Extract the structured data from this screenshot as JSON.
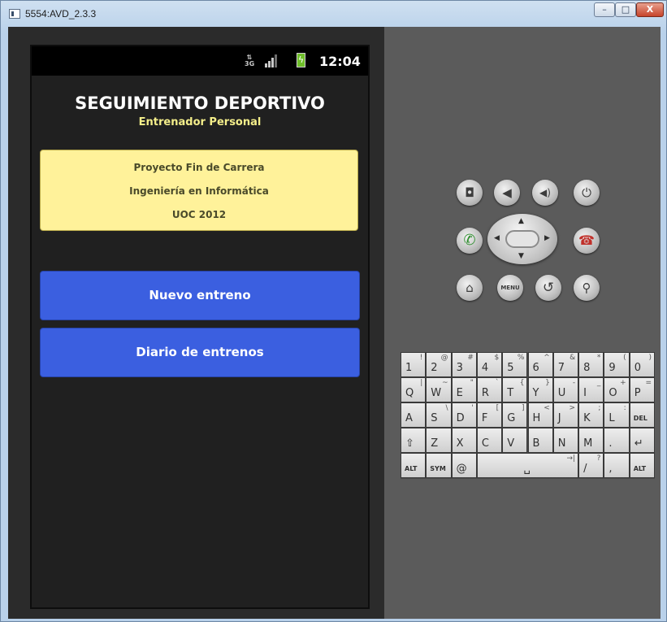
{
  "window": {
    "title": "5554:AVD_2.3.3",
    "min_label": "–",
    "max_label": "□",
    "close_label": "X"
  },
  "statusbar": {
    "network": "3G",
    "clock": "12:04"
  },
  "app": {
    "title": "SEGUIMIENTO DEPORTIVO",
    "subtitle": "Entrenador Personal",
    "info_lines": [
      "Proyecto Fin de Carrera",
      "Ingeniería en Informática",
      "UOC 2012"
    ],
    "buttons": {
      "new": "Nuevo entreno",
      "diary": "Diario de entrenos"
    }
  },
  "emulator": {
    "hardware_buttons": [
      {
        "name": "camera-icon",
        "glyph": "◘"
      },
      {
        "name": "volume-down-icon",
        "glyph": "◀"
      },
      {
        "name": "volume-up-icon",
        "glyph": "◀)"
      },
      {
        "name": "power-icon",
        "glyph": "⏻"
      },
      {
        "name": "call-icon",
        "glyph": "✆"
      },
      {
        "name": "end-call-icon",
        "glyph": "☎"
      },
      {
        "name": "home-icon",
        "glyph": "⌂"
      },
      {
        "name": "menu-icon",
        "glyph": "MENU"
      },
      {
        "name": "back-icon",
        "glyph": "↺"
      },
      {
        "name": "search-icon",
        "glyph": "⚲"
      }
    ],
    "keyboard": {
      "row1": [
        [
          "1",
          "!"
        ],
        [
          "2",
          "@"
        ],
        [
          "3",
          "#"
        ],
        [
          "4",
          "$"
        ],
        [
          "5",
          "%"
        ],
        [
          "6",
          "^"
        ],
        [
          "7",
          "&"
        ],
        [
          "8",
          "*"
        ],
        [
          "9",
          "("
        ],
        [
          "0",
          ")"
        ]
      ],
      "row2": [
        [
          "Q",
          "|"
        ],
        [
          "W",
          "~"
        ],
        [
          "E",
          "\""
        ],
        [
          "R",
          "`"
        ],
        [
          "T",
          "{"
        ],
        [
          "Y",
          "}"
        ],
        [
          "U",
          "-"
        ],
        [
          "I",
          "_"
        ],
        [
          "O",
          "+"
        ],
        [
          "P",
          "="
        ]
      ],
      "row3": [
        [
          "A",
          ""
        ],
        [
          "S",
          "\\"
        ],
        [
          "D",
          "'"
        ],
        [
          "F",
          "["
        ],
        [
          "G",
          "]"
        ],
        [
          "H",
          "<"
        ],
        [
          "J",
          ">"
        ],
        [
          "K",
          ";"
        ],
        [
          "L",
          ":"
        ],
        [
          "DEL",
          ""
        ]
      ],
      "row4": [
        [
          "⇧",
          ""
        ],
        [
          "Z",
          ""
        ],
        [
          "X",
          ""
        ],
        [
          "C",
          ""
        ],
        [
          "V",
          ""
        ],
        [
          "B",
          ""
        ],
        [
          "N",
          ""
        ],
        [
          "M",
          ""
        ],
        [
          ".",
          ""
        ],
        [
          "↵",
          ""
        ]
      ],
      "row5": [
        [
          "ALT",
          ""
        ],
        [
          "SYM",
          ""
        ],
        [
          "@",
          ""
        ],
        [
          "␣",
          "→|"
        ],
        [
          "/",
          "?"
        ],
        [
          ",",
          ""
        ],
        [
          "ALT",
          ""
        ]
      ]
    }
  },
  "colors": {
    "button_blue": "#3b5fe0",
    "info_yellow": "#fff29a",
    "subtitle_yellow": "#f4ee8a"
  }
}
